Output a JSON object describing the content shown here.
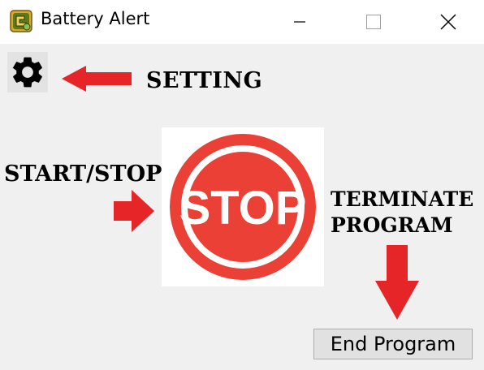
{
  "window": {
    "title": "Battery Alert",
    "icon": "battery-alert-app-icon",
    "controls": [
      "minimize-icon",
      "maximize-icon",
      "close-icon"
    ]
  },
  "settings": {
    "icon": "gear-icon",
    "caption": "SETTING"
  },
  "start_stop": {
    "caption": "START/STOP",
    "button_text": "STOP",
    "icon": "stop-sign-icon",
    "color": "#ea4035"
  },
  "terminate": {
    "caption_line1": "TERMINATE",
    "caption_line2": "PROGRAM",
    "button_label": "End Program"
  },
  "colors": {
    "arrow": "#e52528",
    "background": "#f0f0f0",
    "titlebar": "#ffffff"
  }
}
